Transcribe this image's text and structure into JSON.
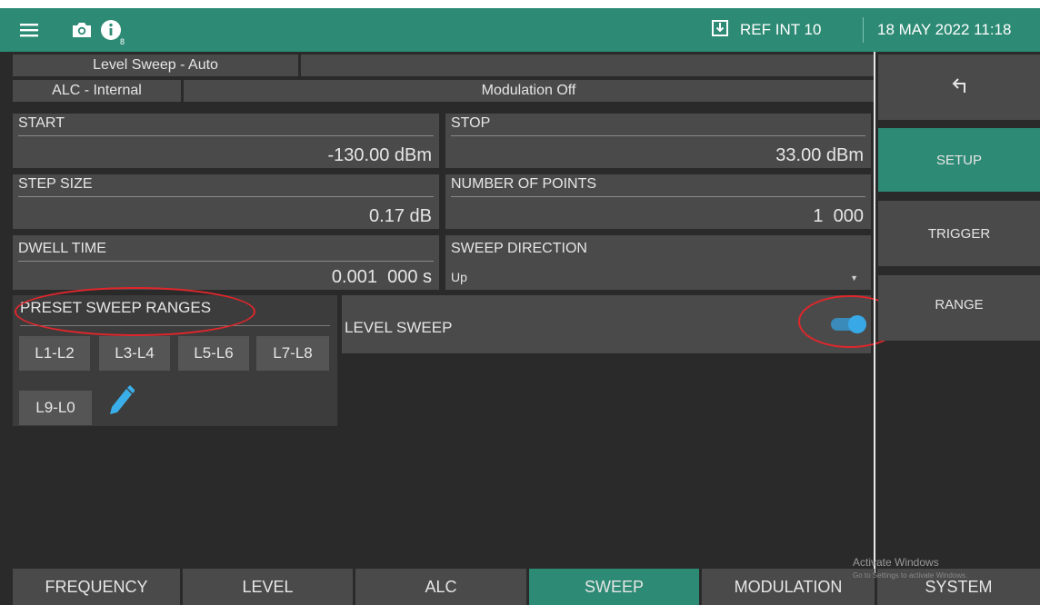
{
  "topbar": {
    "notification_count": "8",
    "ref": "REF INT 10",
    "date": "18 MAY 2022 11:18"
  },
  "status": {
    "sweep_mode": "Level Sweep - Auto",
    "alc": "ALC - Internal",
    "modulation": "Modulation Off"
  },
  "params": {
    "start": {
      "label": "START",
      "value": "-130.00 dBm"
    },
    "stop": {
      "label": "STOP",
      "value": "33.00 dBm"
    },
    "step_size": {
      "label": "STEP SIZE",
      "value": "0.17 dB"
    },
    "num_points": {
      "label": "NUMBER OF POINTS",
      "value": "1  000"
    },
    "dwell_time": {
      "label": "DWELL TIME",
      "value": "0.001  000 s"
    },
    "sweep_direction": {
      "label": "SWEEP DIRECTION",
      "value": "Up"
    }
  },
  "preset": {
    "title": "PRESET SWEEP RANGES",
    "buttons": [
      "L1-L2",
      "L3-L4",
      "L5-L6",
      "L7-L8",
      "L9-L0"
    ]
  },
  "level_sweep": {
    "label": "LEVEL SWEEP",
    "enabled": true
  },
  "side_menu": {
    "back_icon": "return-arrow-icon",
    "items": [
      "SETUP",
      "TRIGGER",
      "RANGE"
    ],
    "selected": "SETUP"
  },
  "tabs": {
    "items": [
      "FREQUENCY",
      "LEVEL",
      "ALC",
      "SWEEP",
      "MODULATION",
      "SYSTEM"
    ],
    "selected": "SWEEP"
  },
  "watermark": {
    "line1": "Activate Windows",
    "line2": "Go to Settings to activate Windows."
  },
  "colors": {
    "accent": "#2d8a74",
    "panel": "#4a4a4a",
    "background": "#2a2a2a",
    "toggle": "#39a8e6",
    "annotation": "#e0262b"
  }
}
